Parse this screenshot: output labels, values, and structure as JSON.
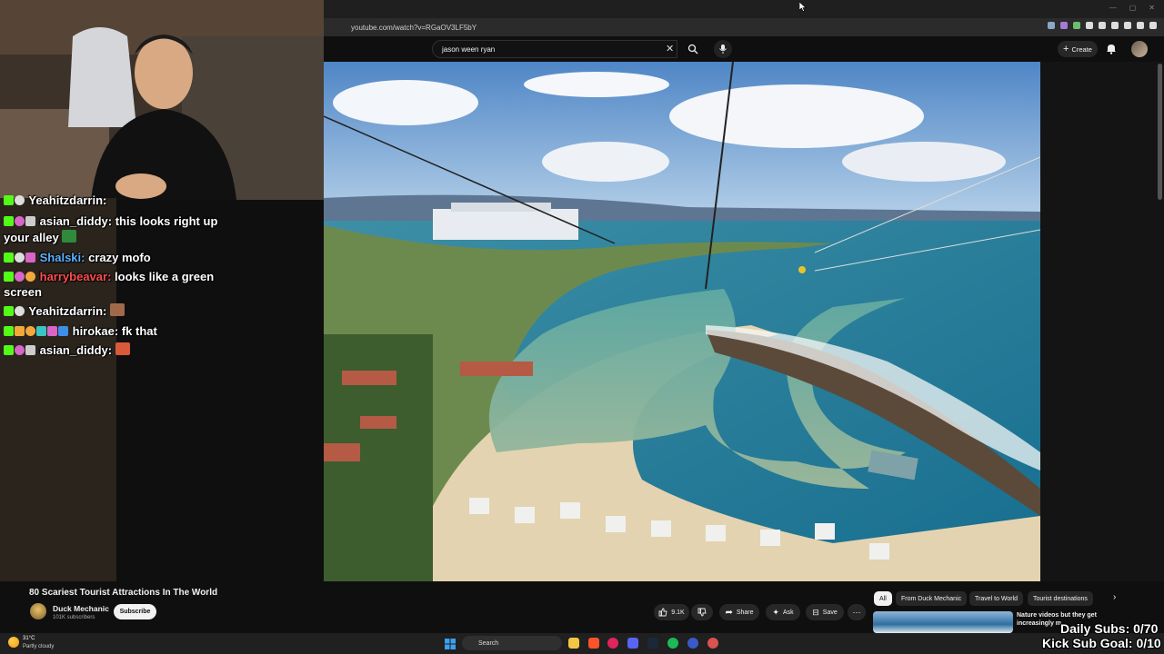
{
  "browser": {
    "url": "youtube.com/watch?v=RGaOV3LF5bY",
    "window_controls": [
      "—",
      "▢",
      "✕"
    ]
  },
  "youtube": {
    "search_value": "jason ween ryan",
    "create_label": "Create"
  },
  "chat": {
    "messages": [
      {
        "user": "Yeahitzdarrin:",
        "text": "",
        "user_color": "#ffffff"
      },
      {
        "user": "asian_diddy:",
        "text": "this looks right up",
        "user_color": "#ffffff"
      },
      {
        "user": "",
        "text": "your alley",
        "user_color": "#ffffff"
      },
      {
        "user": "Shalski:",
        "text": "crazy mofo",
        "user_color": "#5ab0ff"
      },
      {
        "user": "harrybeavar:",
        "text": "looks like a green",
        "user_color": "#ff4d4d"
      },
      {
        "user": "",
        "text": "screen",
        "user_color": "#ffffff"
      },
      {
        "user": "Yeahitzdarrin:",
        "text": "",
        "user_color": "#ffffff"
      },
      {
        "user": "hirokae:",
        "text": "fk that",
        "user_color": "#ffffff"
      },
      {
        "user": "asian_diddy:",
        "text": "",
        "user_color": "#ffffff"
      }
    ]
  },
  "video_info": {
    "title": "80 Scariest Tourist Attractions In The World",
    "channel_name": "Duck Mechanic",
    "channel_subs": "101K subscribers",
    "subscribe_label": "Subscribe",
    "like_count": "9.1K",
    "share_label": "Share",
    "ask_label": "Ask",
    "save_label": "Save"
  },
  "recommendations": {
    "chips": [
      "All",
      "From Duck Mechanic",
      "Travel to World",
      "Tourist destinations"
    ],
    "first_title": "Nature videos but they get increasingly m..."
  },
  "overlays": {
    "daily_subs": "Daily Subs: 0/70",
    "kick_goal": "Kick Sub Goal: 0/10"
  },
  "taskbar": {
    "weather_temp": "31°C",
    "weather_desc": "Partly cloudy",
    "search_placeholder": "Search"
  },
  "colors": {
    "kick_green": "#53fc18",
    "youtube_red": "#ff0000",
    "accent_blue": "#3ea6ff"
  }
}
